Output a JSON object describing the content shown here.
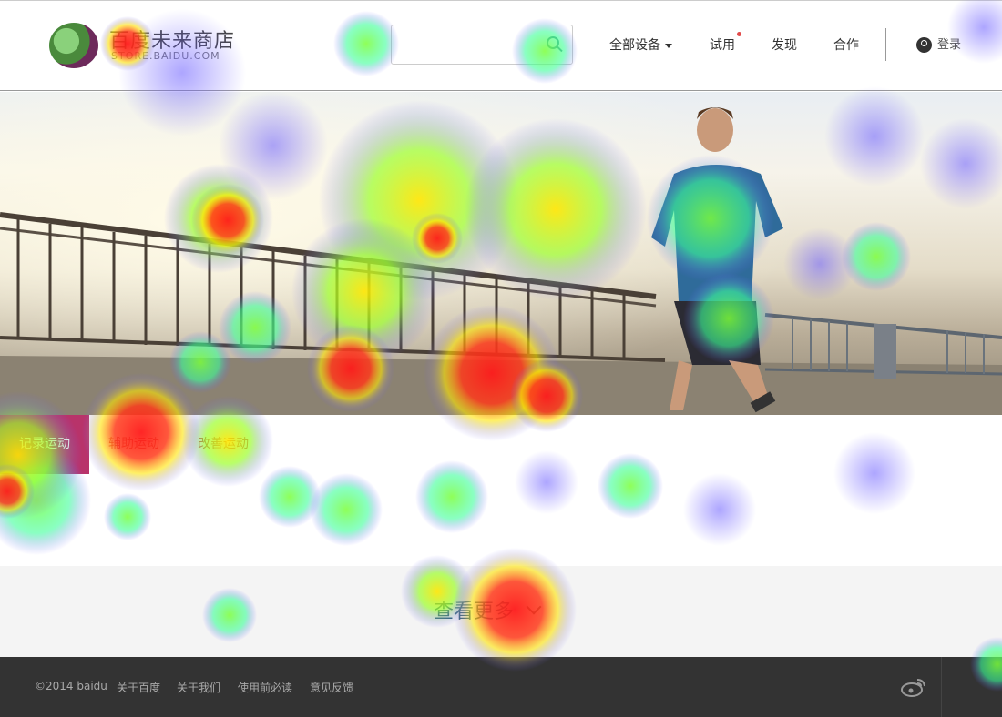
{
  "header": {
    "logo_cn": "百度未来商店",
    "logo_en": "STORE.BAIDU.COM",
    "search_placeholder": "",
    "nav": [
      {
        "label": "全部设备"
      },
      {
        "label": "试用"
      },
      {
        "label": "发现"
      },
      {
        "label": "合作"
      }
    ],
    "login_label": "登录"
  },
  "tabs": [
    {
      "label": "记录运动",
      "active": true
    },
    {
      "label": "辅助运动",
      "active": false
    },
    {
      "label": "改善运动",
      "active": false
    }
  ],
  "more": {
    "label": "查看更多"
  },
  "footer": {
    "copyright": "©2014 baidu",
    "links": [
      "关于百度",
      "关于我们",
      "使用前必读",
      "意见反馈"
    ]
  },
  "colors": {
    "accent": "#b8336a",
    "footer_bg": "#333333",
    "more_band": "#f4f4f4"
  }
}
